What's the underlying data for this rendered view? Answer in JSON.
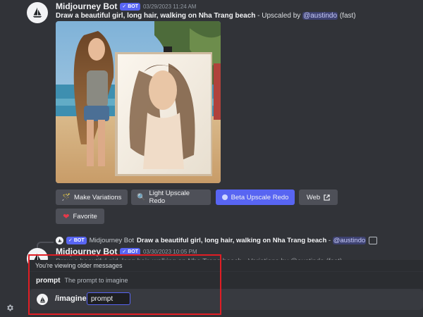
{
  "message1": {
    "username": "Midjourney Bot",
    "badge": "BOT",
    "timestamp": "03/29/2023 11:24 AM",
    "prompt_text": "Draw a beautiful girl, long hair, walking on Nha Trang beach",
    "suffix_prefix": " - Upscaled by ",
    "mention": "@austindo",
    "suffix_end": " (fast)",
    "buttons": {
      "make_variations": "Make Variations",
      "light_upscale_redo": "Light Upscale Redo",
      "beta_upscale_redo": "Beta Upscale Redo",
      "web": "Web",
      "favorite": "Favorite"
    }
  },
  "reply": {
    "badge": "BOT",
    "username": "Midjourney Bot",
    "prompt_text": "Draw a beautiful girl, long hair, walking on Nha Trang beach",
    "separator": " - ",
    "mention": "@austindo"
  },
  "message2": {
    "username": "Midjourney Bot",
    "badge": "BOT",
    "timestamp": "03/30/2023 10:05 PM",
    "text_behind": "Draw a beautiful girl, long hair, walking on Nha Trang beach - Variations by @austindo (fast)"
  },
  "older_bar": {
    "text": "You're viewing older messages"
  },
  "command_hint": {
    "name": "prompt",
    "description": "The prompt to imagine"
  },
  "composer": {
    "command": "/imagine",
    "option": "prompt"
  },
  "colors": {
    "background": "#313338",
    "accent": "#5865f2",
    "highlight_box": "#e11d24"
  }
}
